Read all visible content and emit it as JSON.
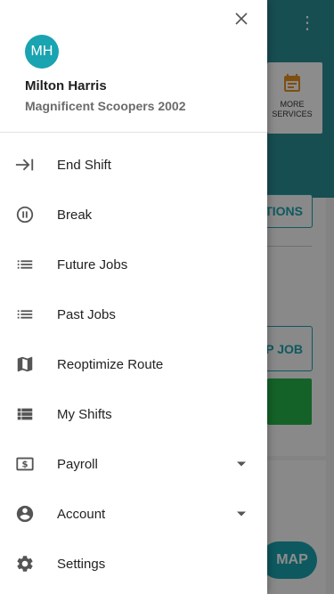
{
  "background": {
    "more_services_label": "MORE SERVICES",
    "options_button_label": "TIONS",
    "skip_job_button_label": "P JOB",
    "map_button_label": "MAP"
  },
  "drawer": {
    "avatar_initials": "MH",
    "user_name": "Milton Harris",
    "company_name": "Magnificent Scoopers 2002",
    "items": [
      {
        "label": "End Shift",
        "icon": "end-shift-icon"
      },
      {
        "label": "Break",
        "icon": "pause-icon"
      },
      {
        "label": "Future Jobs",
        "icon": "list-icon"
      },
      {
        "label": "Past Jobs",
        "icon": "list-icon"
      },
      {
        "label": "Reoptimize Route",
        "icon": "map-icon"
      },
      {
        "label": "My Shifts",
        "icon": "view-list-icon"
      },
      {
        "label": "Payroll",
        "icon": "payroll-icon"
      },
      {
        "label": "Account",
        "icon": "account-icon"
      },
      {
        "label": "Settings",
        "icon": "gear-icon"
      }
    ]
  },
  "colors": {
    "accent": "#1aa3b0",
    "header": "#2a8f96",
    "success": "#27b34a",
    "services_icon": "#e6921e"
  }
}
